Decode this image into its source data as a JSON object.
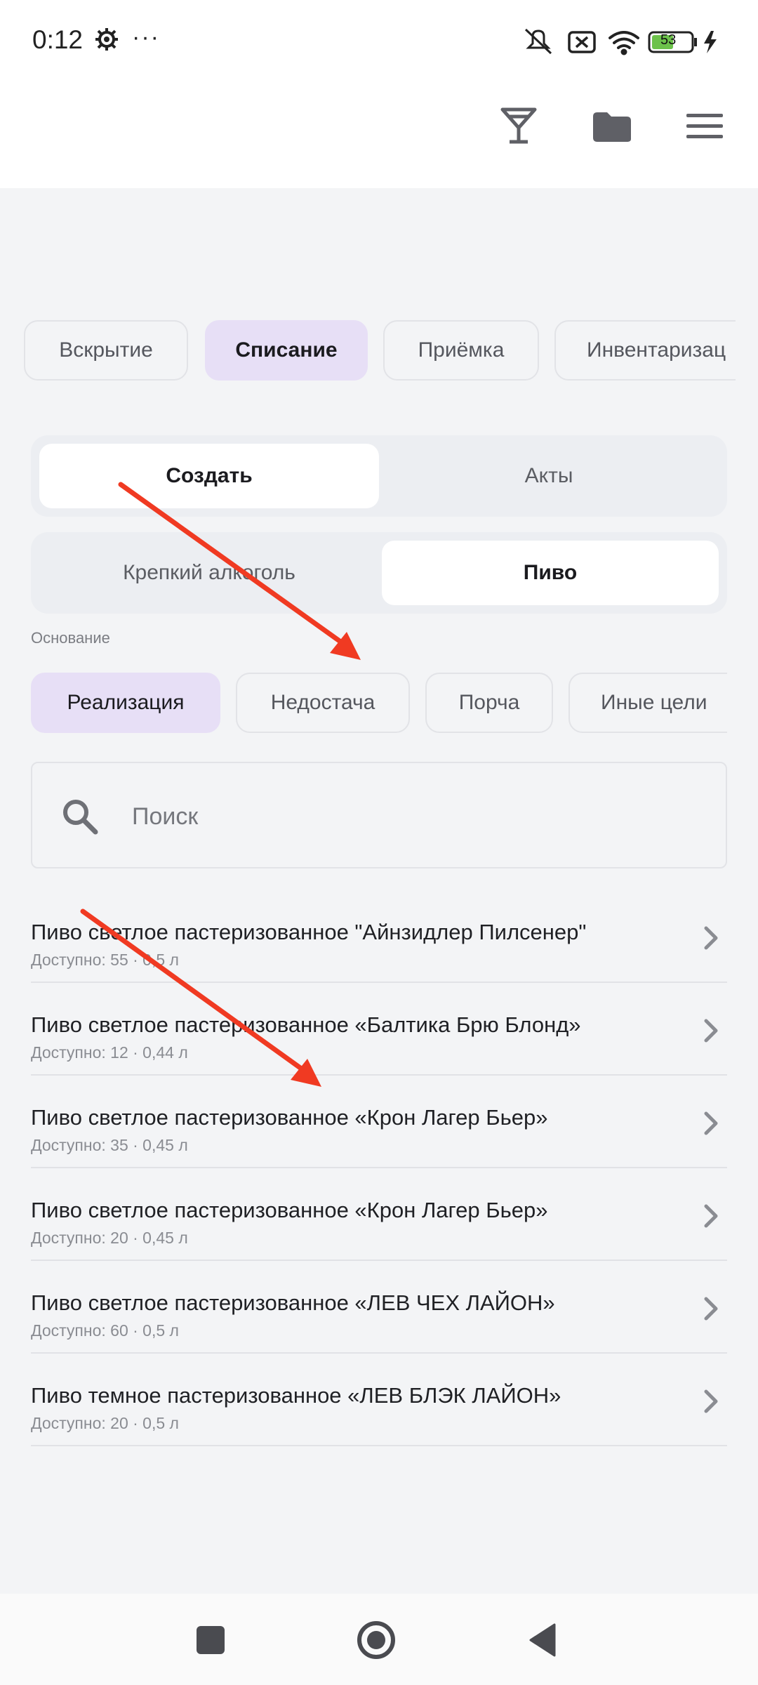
{
  "status_bar": {
    "time": "0:12",
    "more": "···",
    "battery": "53",
    "icons": [
      "gear-icon",
      "mute-icon",
      "sim-x-icon",
      "wifi-icon",
      "battery-icon",
      "charging-icon"
    ]
  },
  "header": {
    "icons": [
      "glass-icon",
      "folder-icon",
      "menu-icon"
    ]
  },
  "tabs": [
    "Вскрытие",
    "Списание",
    "Приёмка",
    "Инвентаризац"
  ],
  "mode_segment": {
    "create": "Создать",
    "acts": "Акты"
  },
  "type_segment": {
    "strong": "Крепкий алкоголь",
    "beer": "Пиво"
  },
  "reason": {
    "label": "Основание",
    "options": [
      "Реализация",
      "Недостача",
      "Порча",
      "Иные цели"
    ]
  },
  "search": {
    "placeholder": "Поиск"
  },
  "items": [
    {
      "title": "Пиво светлое пастеризованное \"Айнзидлер Пилсенер\"",
      "subtitle": "Доступно: 55 · 0,5 л"
    },
    {
      "title": "Пиво светлое пастеризованное «Балтика Брю Блонд»",
      "subtitle": "Доступно: 12 · 0,44 л"
    },
    {
      "title": "Пиво светлое пастеризованное «Крон Лагер Бьер»",
      "subtitle": "Доступно: 35 · 0,45 л"
    },
    {
      "title": "Пиво светлое пастеризованное «Крон Лагер Бьер»",
      "subtitle": "Доступно: 20 · 0,45 л"
    },
    {
      "title": "Пиво светлое пастеризованное «ЛЕВ ЧЕХ ЛАЙОН»",
      "subtitle": "Доступно: 60 · 0,5 л"
    },
    {
      "title": "Пиво темное пастеризованное «ЛЕВ БЛЭК ЛАЙОН»",
      "subtitle": "Доступно: 20 · 0,5 л"
    }
  ],
  "colors": {
    "accent_chip": "#e7dff6",
    "annotation_arrow": "#f03a22",
    "background": "#f3f4f6"
  }
}
